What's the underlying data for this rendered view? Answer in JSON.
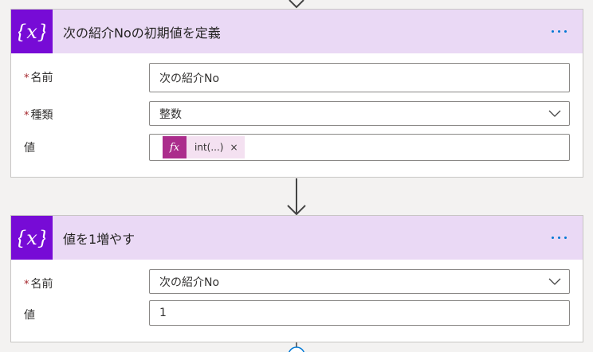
{
  "colors": {
    "header_bg": "#ead9f5",
    "icon_bg": "#770bd6",
    "accent": "#0078d4",
    "required": "#a4262c",
    "token_icon_bg": "#ab2d8c",
    "token_bg": "#f4e1f1"
  },
  "card1": {
    "icon": "variable-icon",
    "title": "次の紹介Noの初期値を定義",
    "name_label": "名前",
    "name_value": "次の紹介No",
    "type_label": "種類",
    "type_value": "整数",
    "value_label": "値",
    "token_icon": "fx",
    "token_label": "int(...)",
    "token_close": "×"
  },
  "card2": {
    "icon": "variable-icon",
    "title": "値を1増やす",
    "name_label": "名前",
    "name_value": "次の紹介No",
    "value_label": "値",
    "value_value": "1"
  },
  "required_mark": "*"
}
